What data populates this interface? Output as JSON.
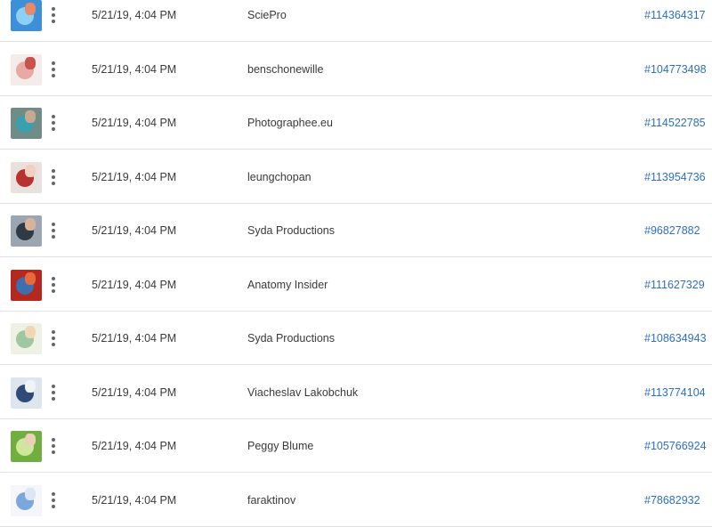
{
  "rows": [
    {
      "date": "5/21/19, 4:04 PM",
      "author": "SciePro",
      "asset_id": "#114364317",
      "thumb": {
        "bg": "#3d8fd8",
        "a": "#8ed0f5",
        "b": "#e38b6b"
      }
    },
    {
      "date": "5/21/19, 4:04 PM",
      "author": "benschonewille",
      "asset_id": "#104773498",
      "thumb": {
        "bg": "#f3eceb",
        "a": "#e7a9a4",
        "b": "#c9524d"
      }
    },
    {
      "date": "5/21/19, 4:04 PM",
      "author": "Photographee.eu",
      "asset_id": "#114522785",
      "thumb": {
        "bg": "#6f8c86",
        "a": "#3a9fae",
        "b": "#c9a892"
      }
    },
    {
      "date": "5/21/19, 4:04 PM",
      "author": "leungchopan",
      "asset_id": "#113954736",
      "thumb": {
        "bg": "#e9e1dd",
        "a": "#b8332f",
        "b": "#f0d0bf"
      }
    },
    {
      "date": "5/21/19, 4:04 PM",
      "author": "Syda Productions",
      "asset_id": "#96827882",
      "thumb": {
        "bg": "#9aa7b2",
        "a": "#2f3a44",
        "b": "#d8b29a"
      }
    },
    {
      "date": "5/21/19, 4:04 PM",
      "author": "Anatomy Insider",
      "asset_id": "#111627329",
      "thumb": {
        "bg": "#b52820",
        "a": "#3b6fb0",
        "b": "#e66a3b"
      }
    },
    {
      "date": "5/21/19, 4:04 PM",
      "author": "Syda Productions",
      "asset_id": "#108634943",
      "thumb": {
        "bg": "#eef2e4",
        "a": "#9fc7a0",
        "b": "#f1d7b8"
      }
    },
    {
      "date": "5/21/19, 4:04 PM",
      "author": "Viacheslav Lakobchuk",
      "asset_id": "#113774104",
      "thumb": {
        "bg": "#dfe5ee",
        "a": "#2e4a77",
        "b": "#f0f2f6"
      }
    },
    {
      "date": "5/21/19, 4:04 PM",
      "author": "Peggy Blume",
      "asset_id": "#105766924",
      "thumb": {
        "bg": "#6fae3f",
        "a": "#cde89c",
        "b": "#ead0b6"
      }
    },
    {
      "date": "5/21/19, 4:04 PM",
      "author": "faraktinov",
      "asset_id": "#78682932",
      "thumb": {
        "bg": "#f4f6fa",
        "a": "#7aa8dc",
        "b": "#dde7f4"
      }
    }
  ]
}
